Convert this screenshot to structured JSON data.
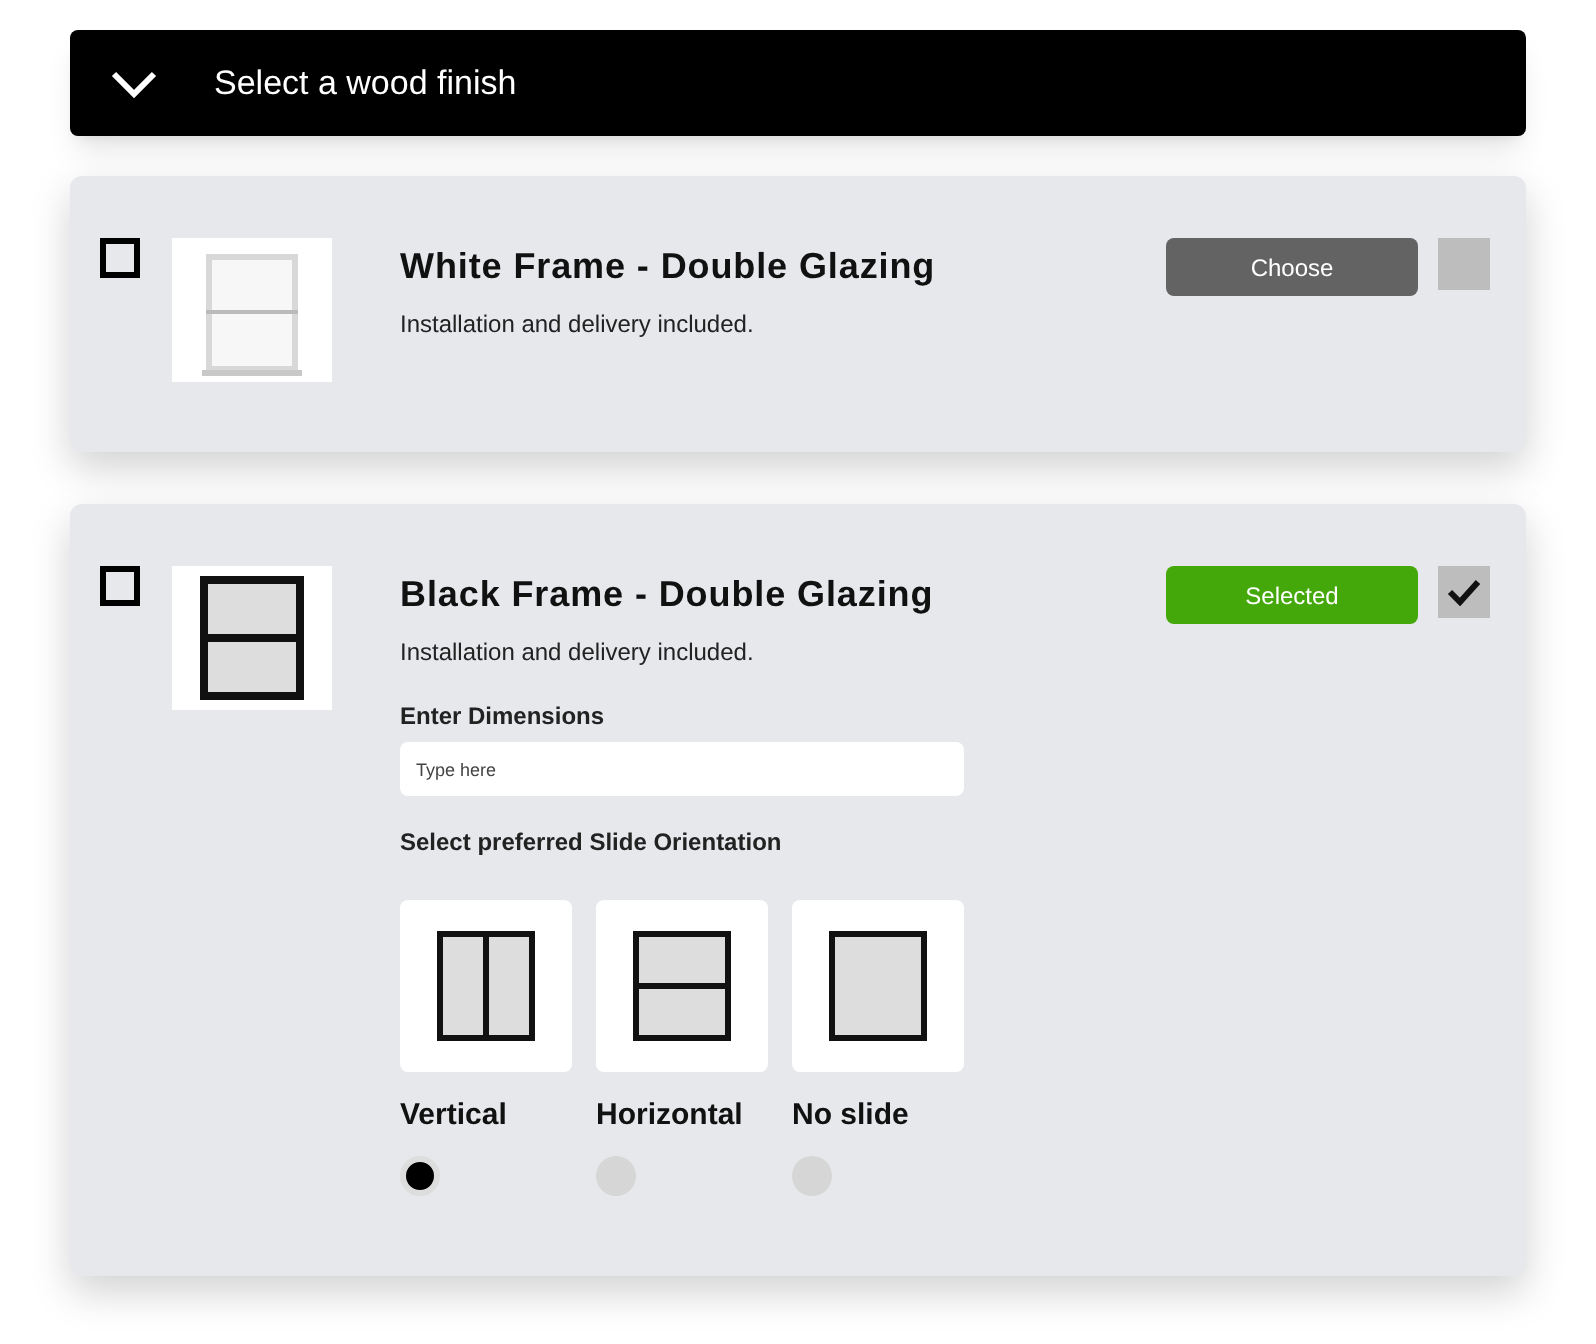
{
  "header": {
    "title": "Select a wood finish",
    "expanded": true
  },
  "products": [
    {
      "title": "White Frame - Double Glazing",
      "description": "Installation and delivery included.",
      "checked": false,
      "button": "Choose",
      "selected": false
    },
    {
      "title": "Black Frame - Double Glazing",
      "description": "Installation and delivery included.",
      "kind": "drawing",
      "checked": false,
      "button": "Selected",
      "selected": true,
      "details": {
        "dimensions_label": "Enter Dimensions",
        "dimensions_placeholder": "Type here",
        "orientation_label": "Select preferred Slide Orientation",
        "orientations": [
          {
            "kind": "vertical",
            "label": "Vertical",
            "selected": true
          },
          {
            "kind": "horizontal",
            "label": "Horizontal",
            "selected": false
          },
          {
            "kind": "none",
            "label": "No slide",
            "selected": false
          }
        ]
      }
    }
  ]
}
